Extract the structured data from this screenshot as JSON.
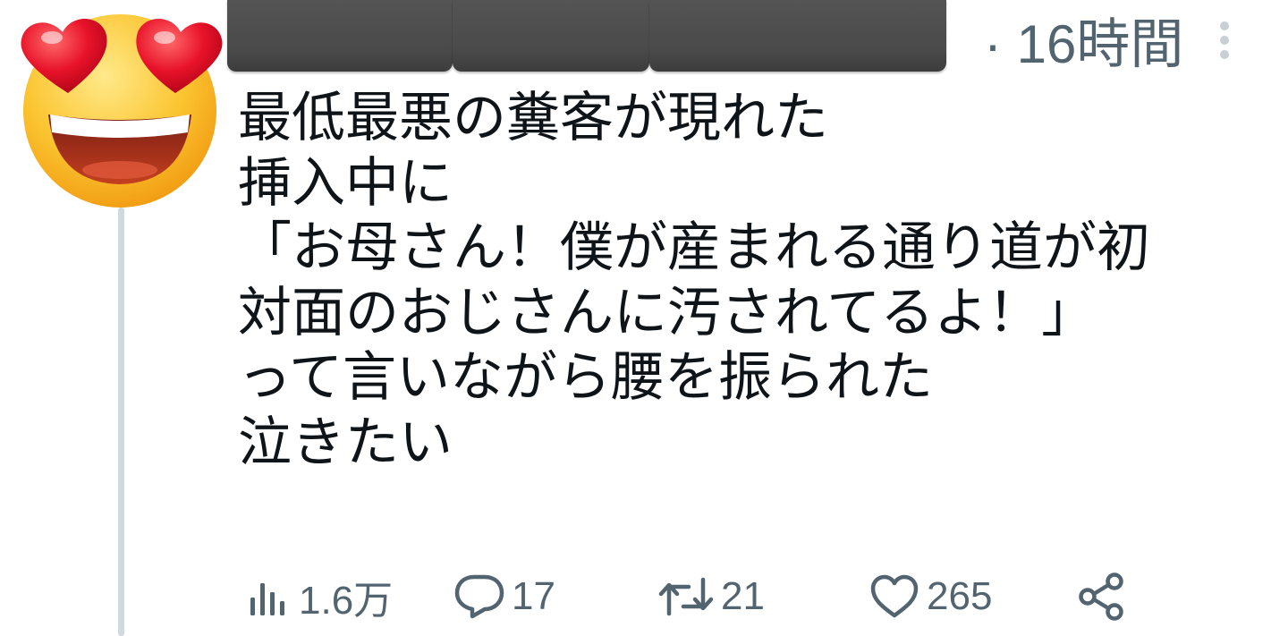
{
  "avatar": {
    "icon": "heart-eyes-emoji-icon"
  },
  "header": {
    "time": "· 16時間",
    "more_icon": "more-vertical-icon"
  },
  "post": {
    "lines": [
      "最低最悪の糞客が現れた",
      "挿入中に",
      "「お母さん！僕が産まれる通り道が初",
      "対面のおじさんに汚されてるよ！」",
      "って言いながら腰を振られた",
      "泣きたい"
    ]
  },
  "actions": {
    "views": {
      "icon": "views-chart-icon",
      "count": "1.6万"
    },
    "replies": {
      "icon": "reply-bubble-icon",
      "count": "17"
    },
    "reposts": {
      "icon": "repost-icon",
      "count": "21"
    },
    "likes": {
      "icon": "heart-icon",
      "count": "265"
    },
    "share": {
      "icon": "share-icon"
    }
  },
  "colors": {
    "text": "#0f1419",
    "muted": "#536471",
    "thread_line": "#cfd9de",
    "redaction": "#4a4a4a"
  }
}
